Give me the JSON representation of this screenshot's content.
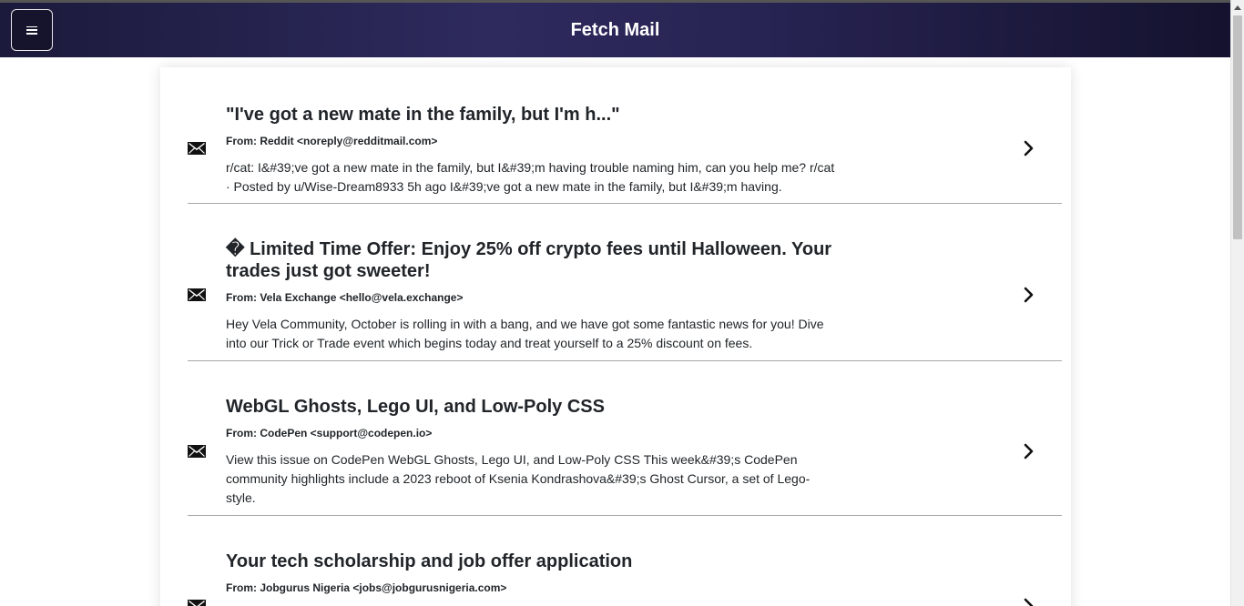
{
  "header": {
    "title": "Fetch Mail",
    "menu_icon": "hamburger-menu-icon"
  },
  "icons": {
    "mail": "envelope-icon",
    "open": "chevron-right-icon"
  },
  "emails": [
    {
      "subject": "\"I've got a new mate in the family, but I'm h...\"",
      "from": "From: Reddit <noreply@redditmail.com>",
      "preview": "r/cat: I&#39;ve got a new mate in the family, but I&#39;m having trouble naming him, can you help me? r/cat · Posted by u/Wise-Dream8933 5h ago I&#39;ve got a new mate in the family, but I&#39;m having."
    },
    {
      "subject": "� Limited Time Offer: Enjoy 25% off crypto fees until Halloween. Your trades just got sweeter!",
      "from": "From: Vela Exchange <hello@vela.exchange>",
      "preview": "Hey Vela Community, October is rolling in with a bang, and we have got some fantastic news for you! Dive into our Trick or Trade event which begins today and treat yourself to a 25% discount on fees."
    },
    {
      "subject": "WebGL Ghosts, Lego UI, and Low-Poly CSS",
      "from": "From: CodePen <support@codepen.io>",
      "preview": "View this issue on CodePen WebGL Ghosts, Lego UI, and Low-Poly CSS This week&#39;s CodePen community highlights include a 2023 reboot of Ksenia Kondrashova&#39;s Ghost Cursor, a set of Lego-style."
    },
    {
      "subject": "Your tech scholarship and job offer application",
      "from": "From: Jobgurus Nigeria <jobs@jobgurusnigeria.com>",
      "preview": ""
    }
  ]
}
